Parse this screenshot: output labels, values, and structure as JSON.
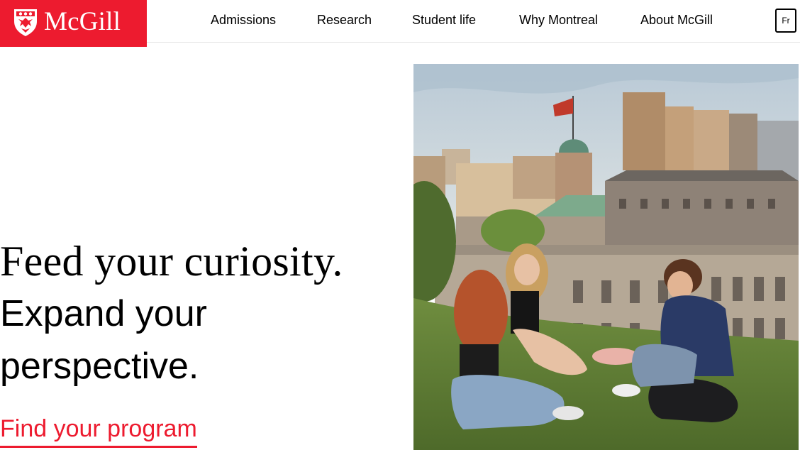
{
  "brand": {
    "name": "McGill",
    "color": "#ed1b2f",
    "logo_icon": "mcgill-shield-icon"
  },
  "nav": {
    "items": [
      {
        "label": "Admissions"
      },
      {
        "label": "Research"
      },
      {
        "label": "Student life"
      },
      {
        "label": "Why Montreal"
      },
      {
        "label": "About McGill"
      }
    ],
    "language_toggle": "Fr"
  },
  "hero": {
    "line1": "Feed your curiosity.",
    "line2": "Expand your",
    "line3": "perspective.",
    "cta": "Find your program",
    "image_alt_subject": "students-on-hill-photo"
  }
}
